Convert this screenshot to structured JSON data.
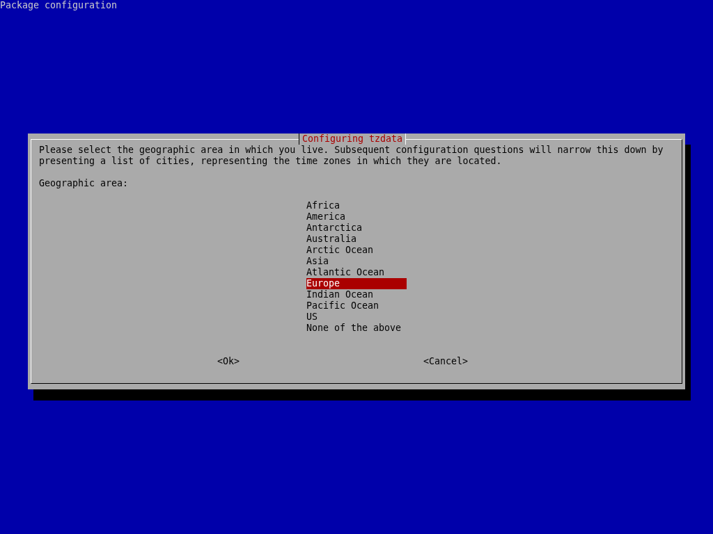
{
  "screen_title": "Package configuration",
  "dialog": {
    "title": "Configuring tzdata",
    "description": "Please select the geographic area in which you live. Subsequent configuration questions will narrow this down by presenting a list of cities, representing the time zones in which they are located.",
    "prompt": "Geographic area:",
    "areas": [
      {
        "label": "Africa",
        "selected": false
      },
      {
        "label": "America",
        "selected": false
      },
      {
        "label": "Antarctica",
        "selected": false
      },
      {
        "label": "Australia",
        "selected": false
      },
      {
        "label": "Arctic Ocean",
        "selected": false
      },
      {
        "label": "Asia",
        "selected": false
      },
      {
        "label": "Atlantic Ocean",
        "selected": false
      },
      {
        "label": "Europe",
        "selected": true
      },
      {
        "label": "Indian Ocean",
        "selected": false
      },
      {
        "label": "Pacific Ocean",
        "selected": false
      },
      {
        "label": "US",
        "selected": false
      },
      {
        "label": "None of the above",
        "selected": false
      }
    ],
    "buttons": [
      {
        "label": "<Ok>"
      },
      {
        "label": "<Cancel>"
      }
    ]
  }
}
